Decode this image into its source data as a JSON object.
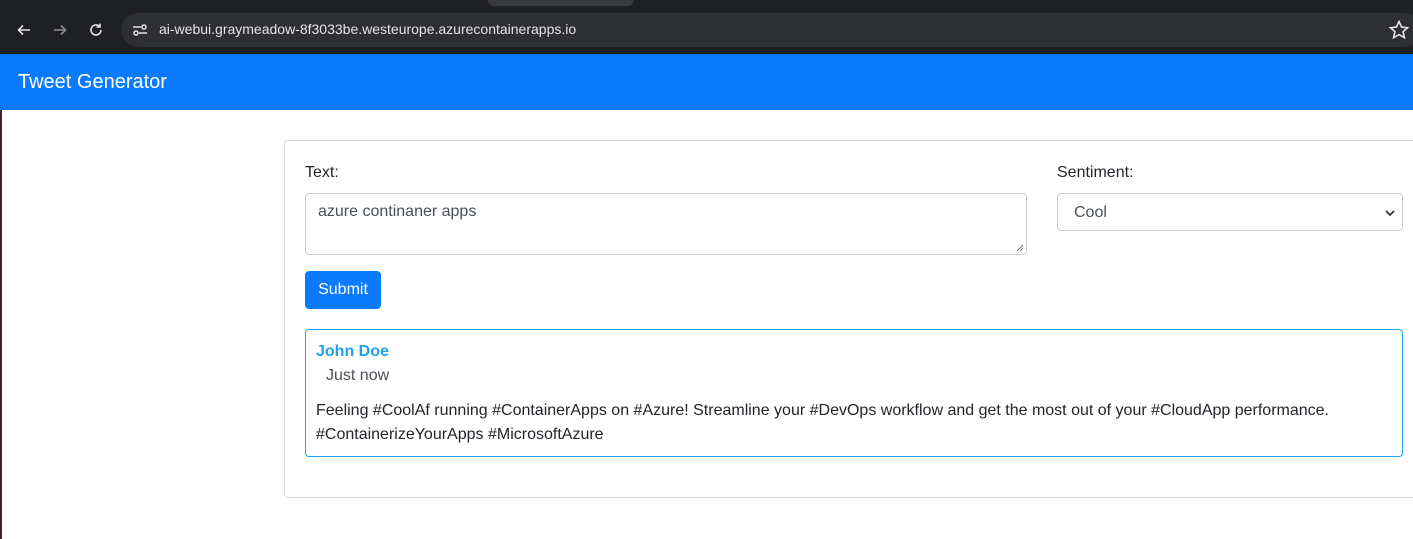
{
  "browser": {
    "url": "ai-webui.graymeadow-8f3033be.westeurope.azurecontainerapps.io",
    "icons": [
      "back-icon",
      "forward-icon",
      "reload-icon",
      "site-info-icon",
      "bookmark-star-icon"
    ]
  },
  "navbar": {
    "brand": "Tweet Generator",
    "color": "#0a7bff"
  },
  "form": {
    "text_label": "Text:",
    "text_value": "azure continaner apps",
    "sentiment_label": "Sentiment:",
    "sentiment_value": "Cool",
    "submit_label": "Submit"
  },
  "tweet": {
    "author": "John Doe",
    "time": "Just now",
    "body_line1": "Feeling #CoolAf running #ContainerApps on #Azure! Streamline your #DevOps workflow and get the most out of your #CloudApp performance.",
    "body_line2": "#ContainerizeYourApps #MicrosoftAzure",
    "accent_color": "#1da1f2"
  }
}
